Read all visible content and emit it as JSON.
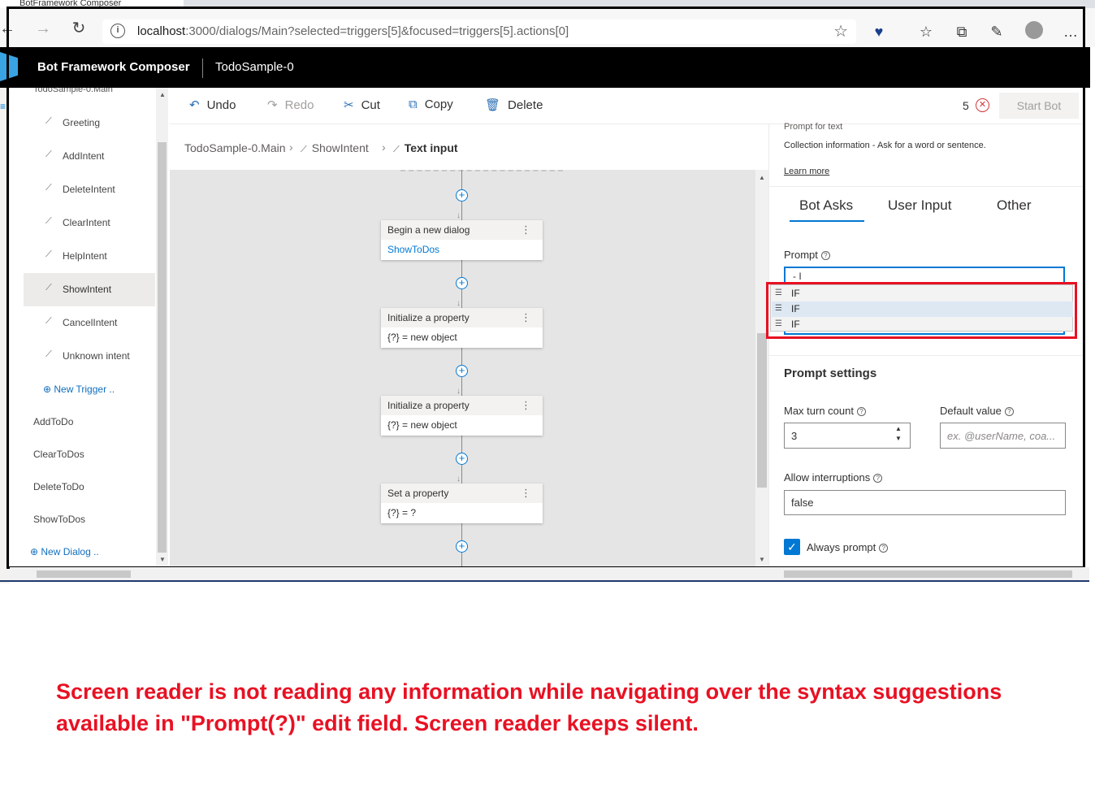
{
  "browser": {
    "tab_title": "BotFramework Composer",
    "url_host": "localhost",
    "url_path": ":3000/dialogs/Main?selected=triggers[5]&focused=triggers[5].actions[0]"
  },
  "app": {
    "title": "Bot Framework Composer",
    "bot_name": "TodoSample-0"
  },
  "toolbar": {
    "undo": "Undo",
    "redo": "Redo",
    "cut": "Cut",
    "copy": "Copy",
    "delete": "Delete",
    "error_count": "5",
    "start_bot": "Start Bot"
  },
  "nav": {
    "root": "TodoSample-0.Main",
    "triggers": [
      "Greeting",
      "AddIntent",
      "DeleteIntent",
      "ClearIntent",
      "HelpIntent",
      "ShowIntent",
      "CancelIntent",
      "Unknown intent"
    ],
    "selected_trigger": "ShowIntent",
    "new_trigger": "New Trigger ..",
    "dialogs": [
      "AddToDo",
      "ClearToDos",
      "DeleteToDo",
      "ShowToDos"
    ],
    "new_dialog": "New Dialog .."
  },
  "breadcrumb": [
    "TodoSample-0.Main",
    "ShowIntent",
    "Text input"
  ],
  "canvas": {
    "nodes": [
      {
        "title": "Begin a new dialog",
        "body": "ShowToDos"
      },
      {
        "title": "Initialize a property",
        "body": "{?} = new object"
      },
      {
        "title": "Initialize a property",
        "body": "{?} = new object"
      },
      {
        "title": "Set a property",
        "body": "{?} = ?"
      }
    ]
  },
  "properties": {
    "title": "Prompt for text",
    "description": "Collection information - Ask for a word or sentence.",
    "learn_more": "Learn more",
    "tabs": [
      "Bot Asks",
      "User Input",
      "Other"
    ],
    "active_tab": "Bot Asks",
    "prompt_label": "Prompt",
    "prompt_value": "- I",
    "suggestions": [
      "IF",
      "IF",
      "IF"
    ],
    "highlighted_suggestion_index": 1,
    "prompt_settings_title": "Prompt settings",
    "max_turn_label": "Max turn count",
    "max_turn_value": "3",
    "default_value_label": "Default value",
    "default_value_placeholder": "ex. @userName, coa...",
    "allow_interruptions_label": "Allow interruptions",
    "allow_interruptions_value": "false",
    "always_prompt_label": "Always prompt",
    "always_prompt_checked": true
  },
  "annotation": "Screen reader is not reading any information while navigating over the syntax suggestions available in \"Prompt(?)\" edit field. Screen reader keeps silent.",
  "colors": {
    "accent": "#0078d4",
    "annotation_red": "#e81123",
    "header_bg": "#000000"
  }
}
